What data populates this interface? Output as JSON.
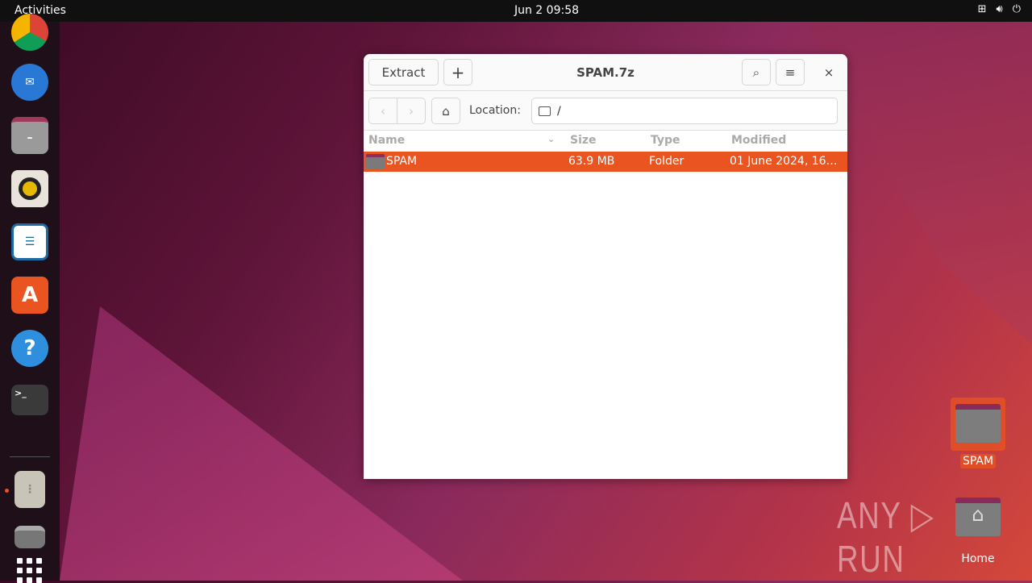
{
  "topbar": {
    "activities": "Activities",
    "clock": "Jun 2  09:58",
    "tray": [
      "network-icon",
      "volume-icon",
      "power-icon"
    ]
  },
  "dock": {
    "apps": [
      "chrome",
      "thunderbird",
      "files",
      "rhythmbox",
      "libreoffice-writer",
      "app-center",
      "help",
      "terminal",
      "archive-manager",
      "drive"
    ]
  },
  "window": {
    "title": "SPAM.7z",
    "extract": "Extract",
    "add": "+",
    "location_label": "Location:",
    "location_value": "/",
    "columns": {
      "name": "Name",
      "size": "Size",
      "type": "Type",
      "modified": "Modified"
    },
    "rows": [
      {
        "name": "SPAM",
        "size": "63.9 MB",
        "type": "Folder",
        "modified": "01 June 2024, 16…"
      }
    ]
  },
  "desktop": {
    "icons": [
      {
        "label": "SPAM"
      },
      {
        "label": "Home"
      }
    ]
  },
  "watermark": "ANY RUN",
  "colors": {
    "accent": "#e95420"
  }
}
